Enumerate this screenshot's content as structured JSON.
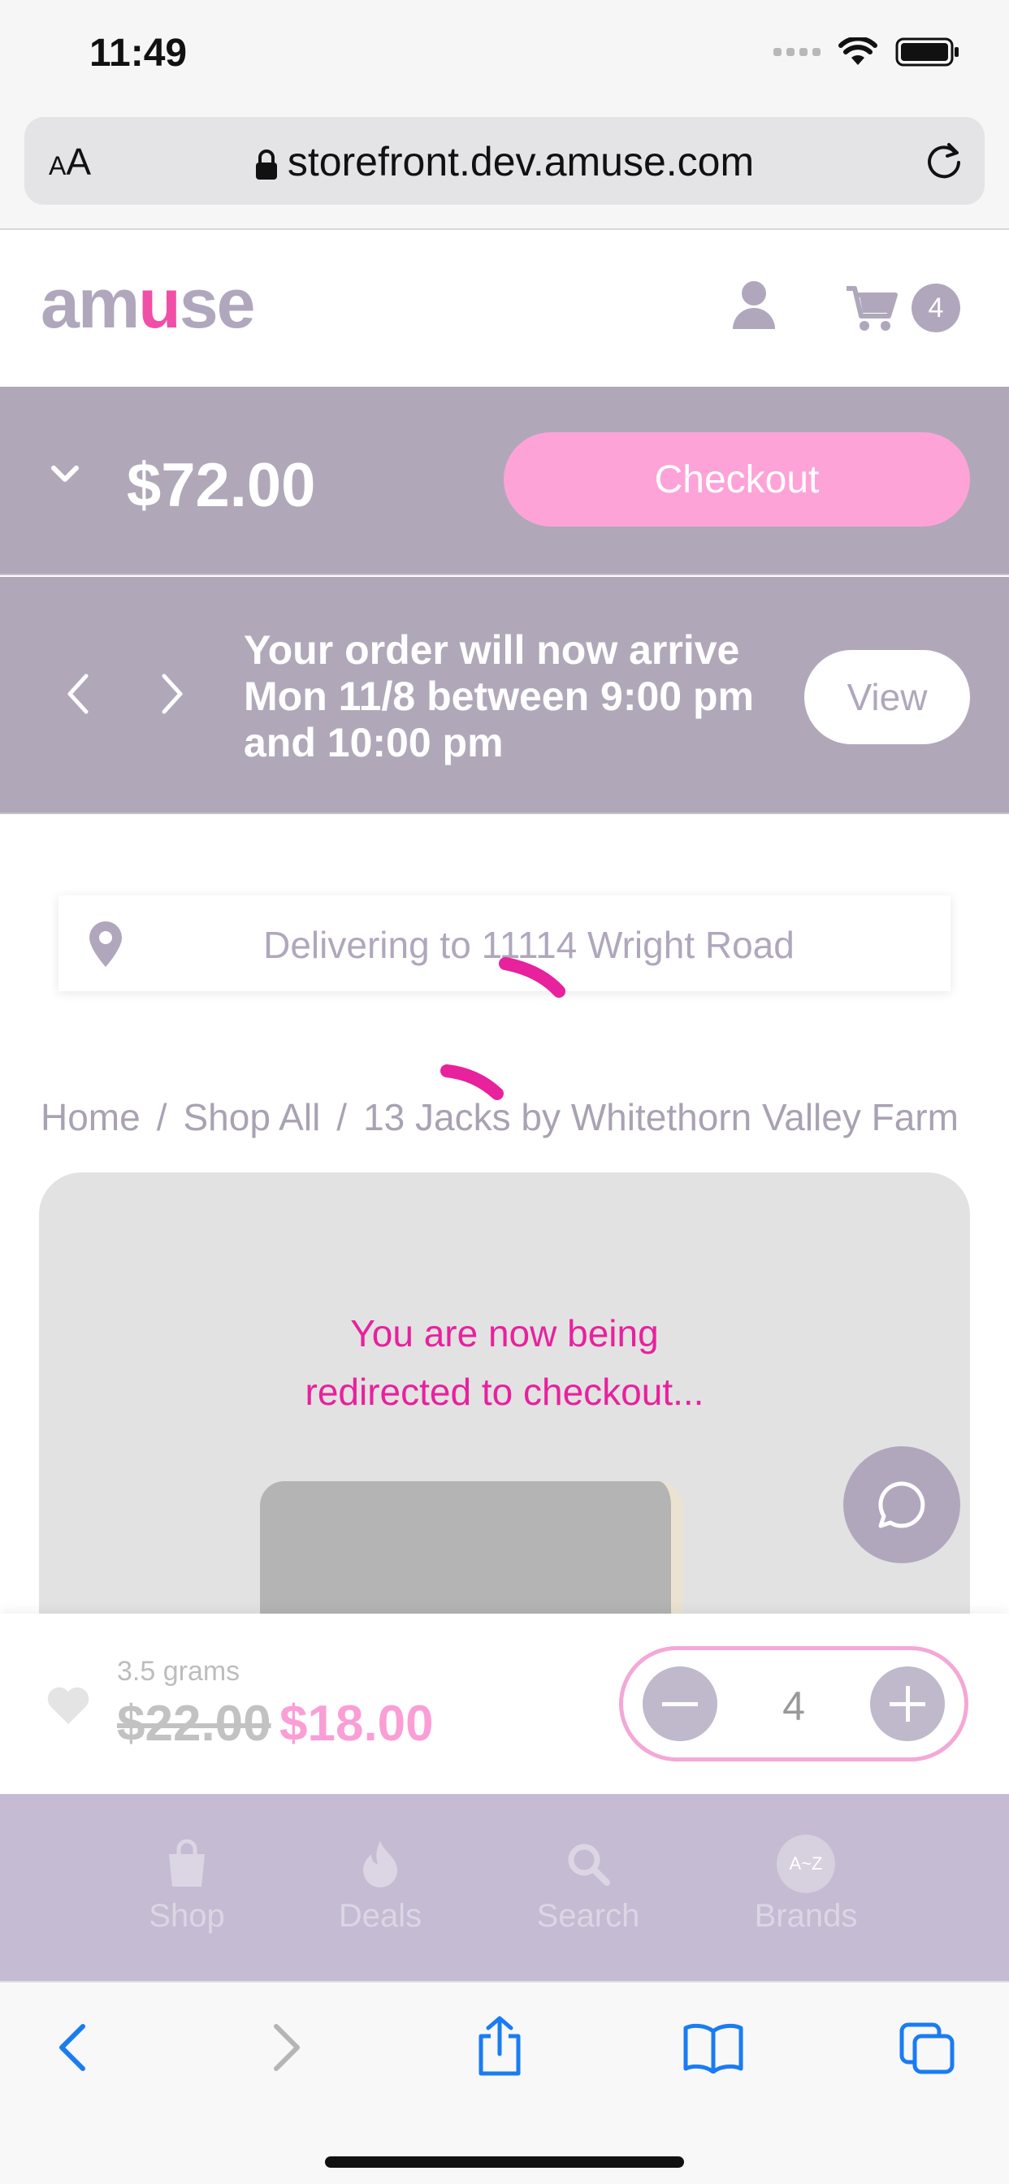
{
  "status_bar": {
    "time": "11:49"
  },
  "browser": {
    "text_size_label": "AA",
    "url": "storefront.dev.amuse.com"
  },
  "header": {
    "logo": {
      "prefix": "am",
      "middle": "u",
      "suffix": "se"
    },
    "cart_count": "4"
  },
  "cart_bar": {
    "total": "$72.00",
    "checkout_label": "Checkout"
  },
  "message_bar": {
    "text": "Your order will now arrive Mon 11/8 between 9:00 pm and 10:00 pm",
    "view_label": "View"
  },
  "address": {
    "text": "Delivering to 11114 Wright Road"
  },
  "breadcrumb": {
    "items": [
      "Home",
      "Shop All",
      "13 Jacks by Whitethorn Valley Farm"
    ],
    "separator": "/"
  },
  "product": {
    "redirect_line1": "You are now being",
    "redirect_line2": "redirected to checkout...",
    "weight": "3.5 grams",
    "old_price": "$22.00",
    "new_price": "$18.00",
    "quantity": "4"
  },
  "bottom_nav": {
    "items": [
      {
        "label": "Shop",
        "icon": "shopping-bag-icon"
      },
      {
        "label": "Deals",
        "icon": "flame-icon"
      },
      {
        "label": "Search",
        "icon": "search-icon"
      },
      {
        "label": "Brands",
        "icon": "brands-az-icon",
        "badge": "A~Z"
      }
    ]
  },
  "colors": {
    "brand_lavender": "#b0a7bd",
    "brand_pink": "#f04fa8",
    "checkout_pink": "#fda3d8",
    "redirect_magenta": "#e8219d",
    "ios_blue": "#1a7cf2"
  }
}
